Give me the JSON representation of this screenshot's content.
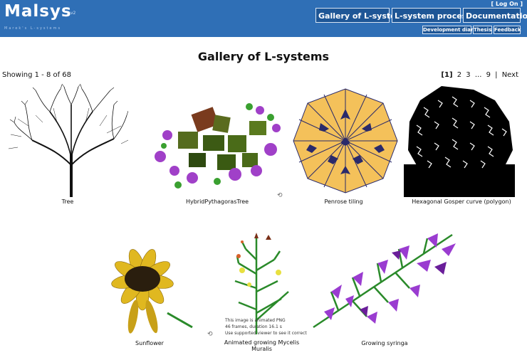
{
  "header": {
    "logo": "Malsys",
    "logo_version": "v2",
    "logo_tagline": "Marek's L-systems",
    "login": "[ Log On ]",
    "nav": [
      "Gallery of L-systems",
      "L-system processor",
      "Documentation"
    ],
    "subnav": [
      "Development diary",
      "Thesis",
      "Feedback"
    ]
  },
  "page": {
    "title": "Gallery of L-systems",
    "showing": "Showing 1 - 8 of 68",
    "pager": {
      "current": "[1]",
      "pages": [
        "2",
        "3",
        "...",
        "9",
        "|",
        "Next"
      ]
    }
  },
  "gallery": [
    {
      "caption": "Tree"
    },
    {
      "caption": "HybridPythagorasTree"
    },
    {
      "caption": "Penrose tiling"
    },
    {
      "caption": "Hexagonal Gosper curve (polygon)"
    },
    {
      "caption": "Sunflower"
    },
    {
      "caption": "Animated growing Mycelis Muralis"
    },
    {
      "caption": "Growing syringa"
    }
  ],
  "overlay_note": [
    "This image is animated PNG",
    "46 frames, duration 16.1 s",
    "Use supported viewer to see it correct"
  ],
  "colors": {
    "header": "#2f6fb6",
    "button": "#1e5696",
    "penrose_yellow": "#f4c15a",
    "penrose_navy": "#2a2a6b"
  }
}
